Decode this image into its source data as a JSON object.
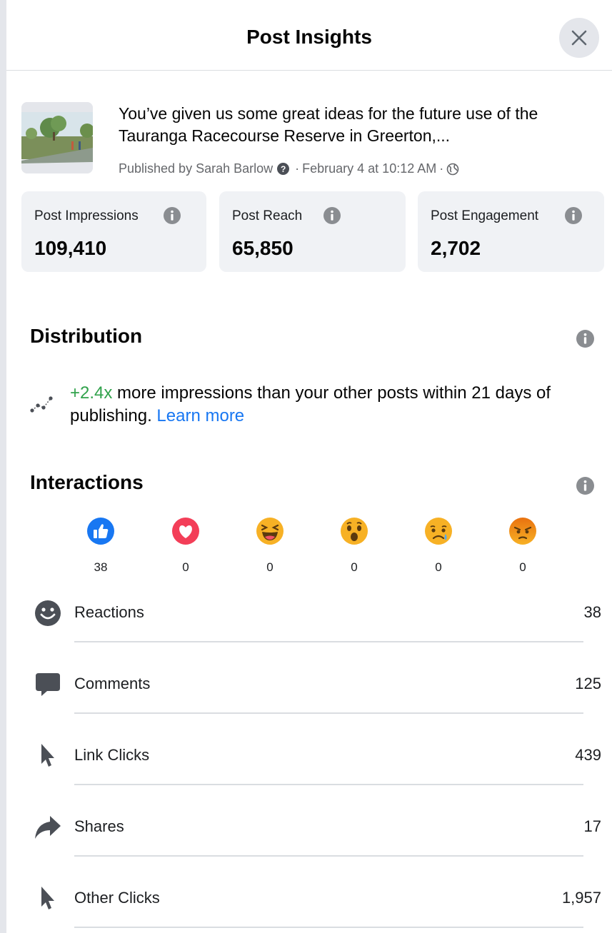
{
  "header": {
    "title": "Post Insights",
    "close_icon": "close-icon"
  },
  "post": {
    "text": "You’ve given us some great ideas for the future use of the Tauranga Racecourse Reserve in Greerton,...",
    "meta_prefix": "Published by Sarah Barlow",
    "meta_date": "February 4 at 10:12 AM",
    "meta_separator": "·",
    "help_icon": "question-icon",
    "audience_icon": "globe-icon",
    "thumbnail": "post-thumbnail-image"
  },
  "metrics": [
    {
      "label": "Post Impressions",
      "value": "109,410"
    },
    {
      "label": "Post Reach",
      "value": "65,850"
    },
    {
      "label": "Post Engagement",
      "value": "2,702"
    }
  ],
  "distribution": {
    "title": "Distribution",
    "highlight": "+2.4x",
    "text": " more impressions than your other posts within 21 days of publishing. ",
    "link": "Learn more",
    "highlight_color": "#31a24c",
    "link_color": "#1877f2"
  },
  "interactions": {
    "title": "Interactions",
    "reactions": [
      {
        "name": "like",
        "count": "38"
      },
      {
        "name": "love",
        "count": "0"
      },
      {
        "name": "haha",
        "count": "0"
      },
      {
        "name": "wow",
        "count": "0"
      },
      {
        "name": "sad",
        "count": "0"
      },
      {
        "name": "angry",
        "count": "0"
      }
    ],
    "rows": [
      {
        "icon": "smiley-icon",
        "label": "Reactions",
        "value": "38"
      },
      {
        "icon": "comment-icon",
        "label": "Comments",
        "value": "125"
      },
      {
        "icon": "cursor-icon",
        "label": "Link Clicks",
        "value": "439"
      },
      {
        "icon": "share-icon",
        "label": "Shares",
        "value": "17"
      },
      {
        "icon": "cursor-icon",
        "label": "Other Clicks",
        "value": "1,957"
      }
    ]
  }
}
